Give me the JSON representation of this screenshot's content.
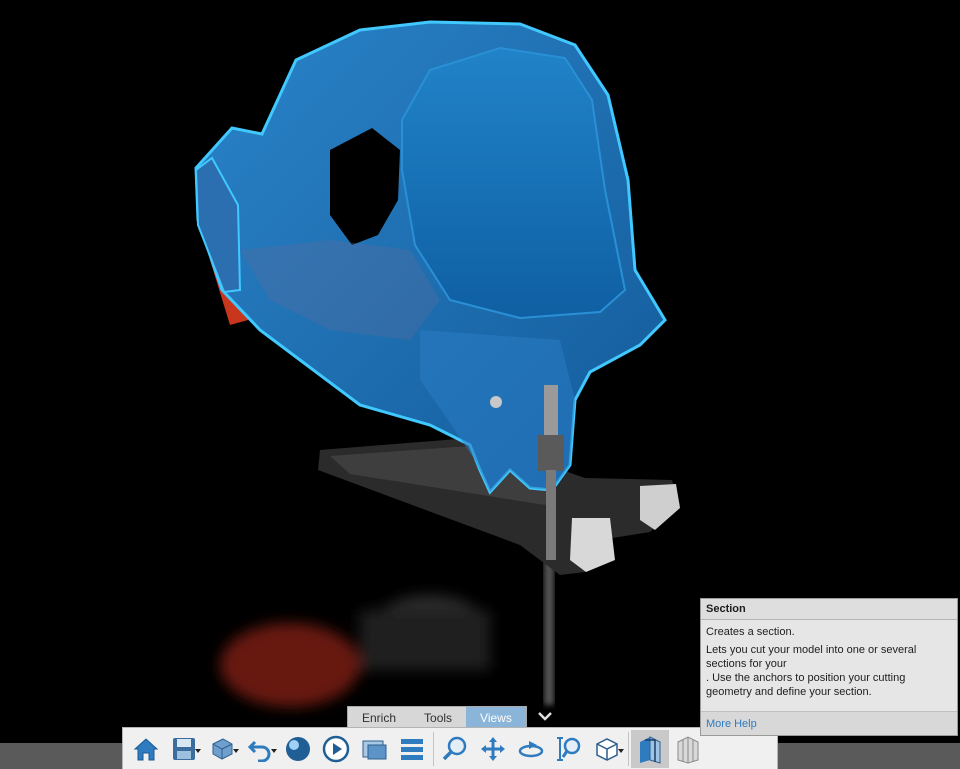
{
  "tabs": [
    {
      "label": "Enrich",
      "active": false
    },
    {
      "label": "Tools",
      "active": false
    },
    {
      "label": "Views",
      "active": true
    }
  ],
  "toolbar": {
    "buttons": [
      {
        "icon": "home-icon"
      },
      {
        "icon": "save-icon",
        "dropdown": true
      },
      {
        "icon": "3d-part-icon",
        "dropdown": true
      },
      {
        "icon": "undo-icon",
        "dropdown": true
      },
      {
        "icon": "render-sphere-icon"
      },
      {
        "icon": "play-icon"
      },
      {
        "icon": "capture-image-icon"
      },
      {
        "icon": "list-icon"
      },
      {
        "icon": "zoom-icon"
      },
      {
        "icon": "pan-icon"
      },
      {
        "icon": "rotate-icon"
      },
      {
        "icon": "zoom-area-icon"
      },
      {
        "icon": "view-cube-icon",
        "dropdown": true
      },
      {
        "icon": "section-icon",
        "active": true
      },
      {
        "icon": "exploded-view-icon"
      }
    ]
  },
  "tooltip": {
    "title": "Section",
    "line1": "Creates a section.",
    "line2": "Lets you cut your model into one or several sections for your",
    "line3": ". Use the anchors to position your cutting geometry and define your section.",
    "link": "More Help"
  },
  "colors": {
    "accent": "#2f7bc0",
    "model_blue": "#1f74b8",
    "highlight": "#40c8ff",
    "battery_red": "#c8361e",
    "active_tab": "#8ab4d8"
  }
}
